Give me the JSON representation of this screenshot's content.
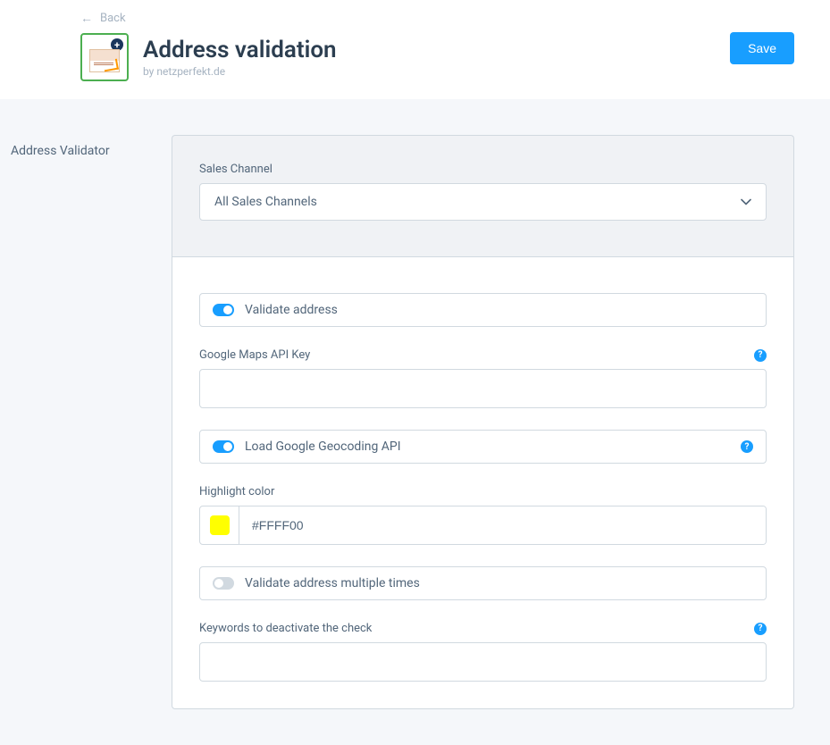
{
  "header": {
    "back_label": "Back",
    "title": "Address validation",
    "subtitle": "by netzperfekt.de",
    "save_label": "Save"
  },
  "sidebar": {
    "label": "Address Validator"
  },
  "top_section": {
    "sales_channel_label": "Sales Channel",
    "sales_channel_value": "All Sales Channels"
  },
  "settings": {
    "validate_address_label": "Validate address",
    "validate_address_on": true,
    "api_key_label": "Google Maps API Key",
    "api_key_value": "",
    "load_geocoding_label": "Load Google Geocoding API",
    "load_geocoding_on": true,
    "highlight_color_label": "Highlight color",
    "highlight_color_value": "#FFFF00",
    "validate_multiple_label": "Validate address multiple times",
    "validate_multiple_on": false,
    "keywords_label": "Keywords to deactivate the check",
    "keywords_value": ""
  }
}
